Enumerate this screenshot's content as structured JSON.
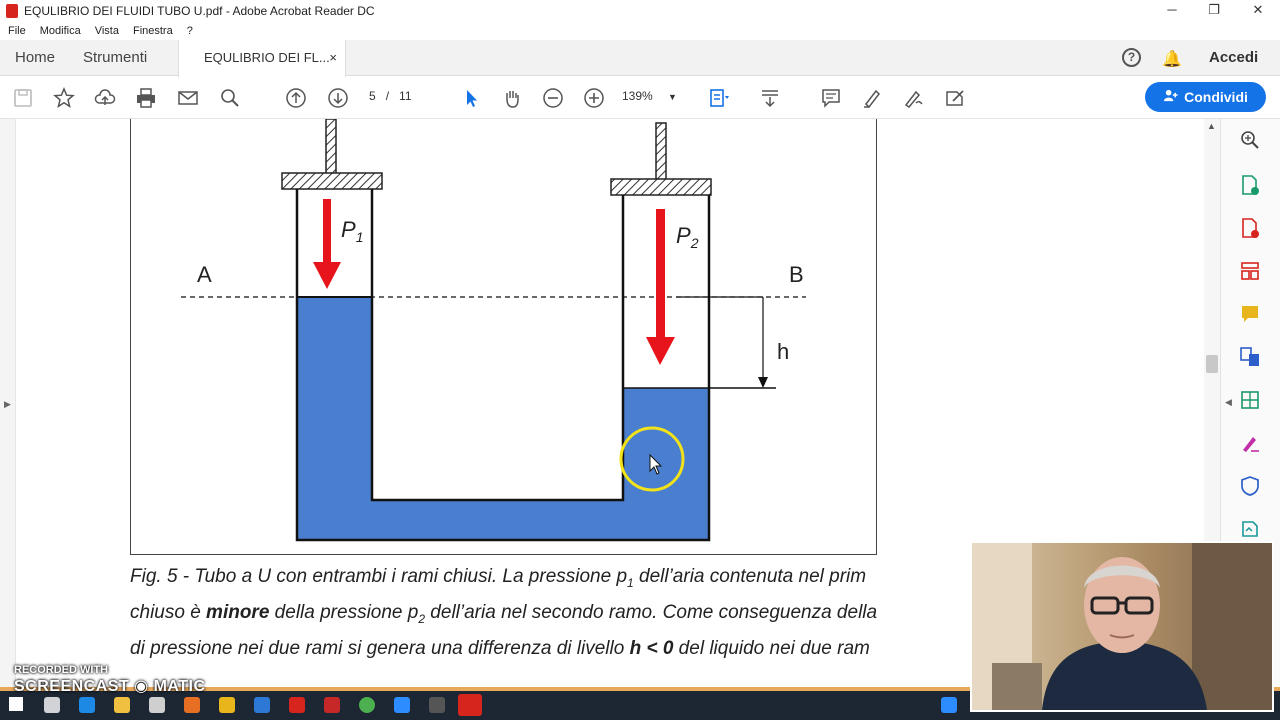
{
  "window": {
    "title": "EQULIBRIO DEI FLUIDI TUBO U.pdf - Adobe Acrobat Reader DC",
    "minimize": "─",
    "restore": "❐",
    "close": "✕"
  },
  "menu": [
    "File",
    "Modifica",
    "Vista",
    "Finestra",
    "?"
  ],
  "tabs": {
    "home": "Home",
    "tools": "Strumenti",
    "document": "EQULIBRIO DEI FL...",
    "document_close": "×",
    "sign_in": "Accedi"
  },
  "toolbar": {
    "page_current": "5",
    "page_sep": "/",
    "page_total": "11",
    "zoom": "139%",
    "share_label": "Condividi"
  },
  "figure": {
    "label_a": "A",
    "label_b": "B",
    "label_h": "h",
    "p1": "P",
    "p1_sub": "1",
    "p2": "P",
    "p2_sub": "2",
    "liquid_color": "#4a7fcf",
    "arrow_color": "#e8141c"
  },
  "caption": {
    "line1": "Fig. 5 -  Tubo a U con entrambi i rami chiusi. La pressione p",
    "line1_sub": "1",
    "line1_end": " dell’aria contenuta nel prim",
    "line2_a": "chiuso è ",
    "line2_bold": "minore",
    "line2_b": " della pressione  p",
    "line2_sub": "2",
    "line2_c": " dell’aria nel secondo ramo. Come conseguenza della",
    "line3_a": "di pressione nei due rami si genera una differenza di livello ",
    "line3_bold": "h < 0",
    "line3_b": " del liquido nei due ram"
  },
  "watermark": {
    "line1": "RECORDED WITH",
    "line2": "SCREENCAST ◉ MATIC"
  },
  "colors": {
    "accent": "#1473e6",
    "acrobat_red": "#d6251c"
  }
}
